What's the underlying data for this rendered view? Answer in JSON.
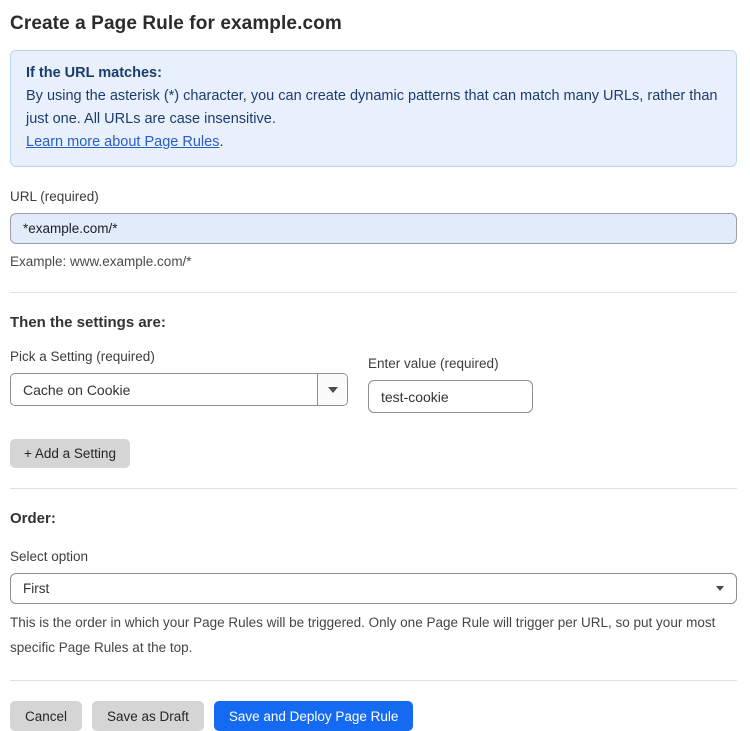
{
  "page": {
    "title": "Create a Page Rule for example.com"
  },
  "info_box": {
    "heading": "If the URL matches:",
    "body": "By using the asterisk (*) character, you can create dynamic patterns that can match many URLs, rather than just one. All URLs are case insensitive.",
    "link": "Learn more about Page Rules",
    "link_suffix": "."
  },
  "url_field": {
    "label": "URL (required)",
    "value": "*example.com/*",
    "helper": "Example: www.example.com/*"
  },
  "settings_section": {
    "heading": "Then the settings are:",
    "setting_label": "Pick a Setting (required)",
    "setting_value": "Cache on Cookie",
    "value_label": "Enter value (required)",
    "value_value": "test-cookie",
    "add_button_label": "+ Add a Setting"
  },
  "order_section": {
    "heading": "Order:",
    "select_label": "Select option",
    "select_value": "First",
    "helper": "This is the order in which your Page Rules will be triggered. Only one Page Rule will trigger per URL, so put your most specific Page Rules at the top."
  },
  "footer": {
    "cancel_label": "Cancel",
    "save_draft_label": "Save as Draft",
    "save_deploy_label": "Save and Deploy Page Rule"
  },
  "colors": {
    "accent_blue": "#156af2",
    "info_background": "#e8f1fb",
    "info_border": "#bcd6ef",
    "info_text": "#1d3c6e",
    "link_blue": "#2b5bc7",
    "url_input_background": "#e1ebfa",
    "gray_button": "#d5d5d5"
  }
}
